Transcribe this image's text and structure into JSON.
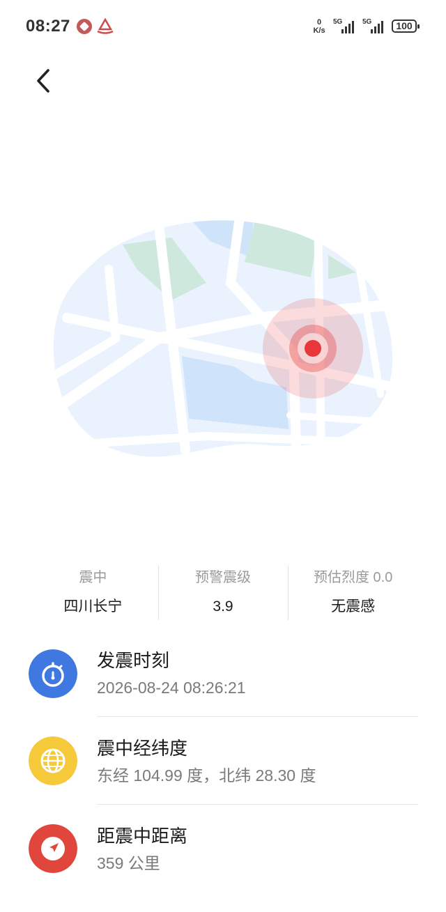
{
  "status_bar": {
    "time": "08:27",
    "net_speed_value": "0",
    "net_speed_unit": "K/s",
    "sim1_label": "5G",
    "sim2_label": "5G",
    "battery": "100"
  },
  "summary": [
    {
      "label": "震中",
      "value": "四川长宁"
    },
    {
      "label": "预警震级",
      "value": "3.9"
    },
    {
      "label": "预估烈度 0.0",
      "value": "无震感"
    }
  ],
  "details": [
    {
      "title": "发震时刻",
      "value": "2026-08-24 08:26:21",
      "icon": "stopwatch-icon",
      "color": "#3f78e0"
    },
    {
      "title": "震中经纬度",
      "value": "东经 104.99 度，北纬 28.30 度",
      "icon": "globe-icon",
      "color": "#f5c93a"
    },
    {
      "title": "距震中距离",
      "value": "359 公里",
      "icon": "navigation-icon",
      "color": "#e0463c"
    }
  ],
  "colors": {
    "map_land": "#eaf3fd",
    "map_water": "#cfe3fa",
    "map_park": "#cfe8dd",
    "epicenter": "#e8363a"
  }
}
